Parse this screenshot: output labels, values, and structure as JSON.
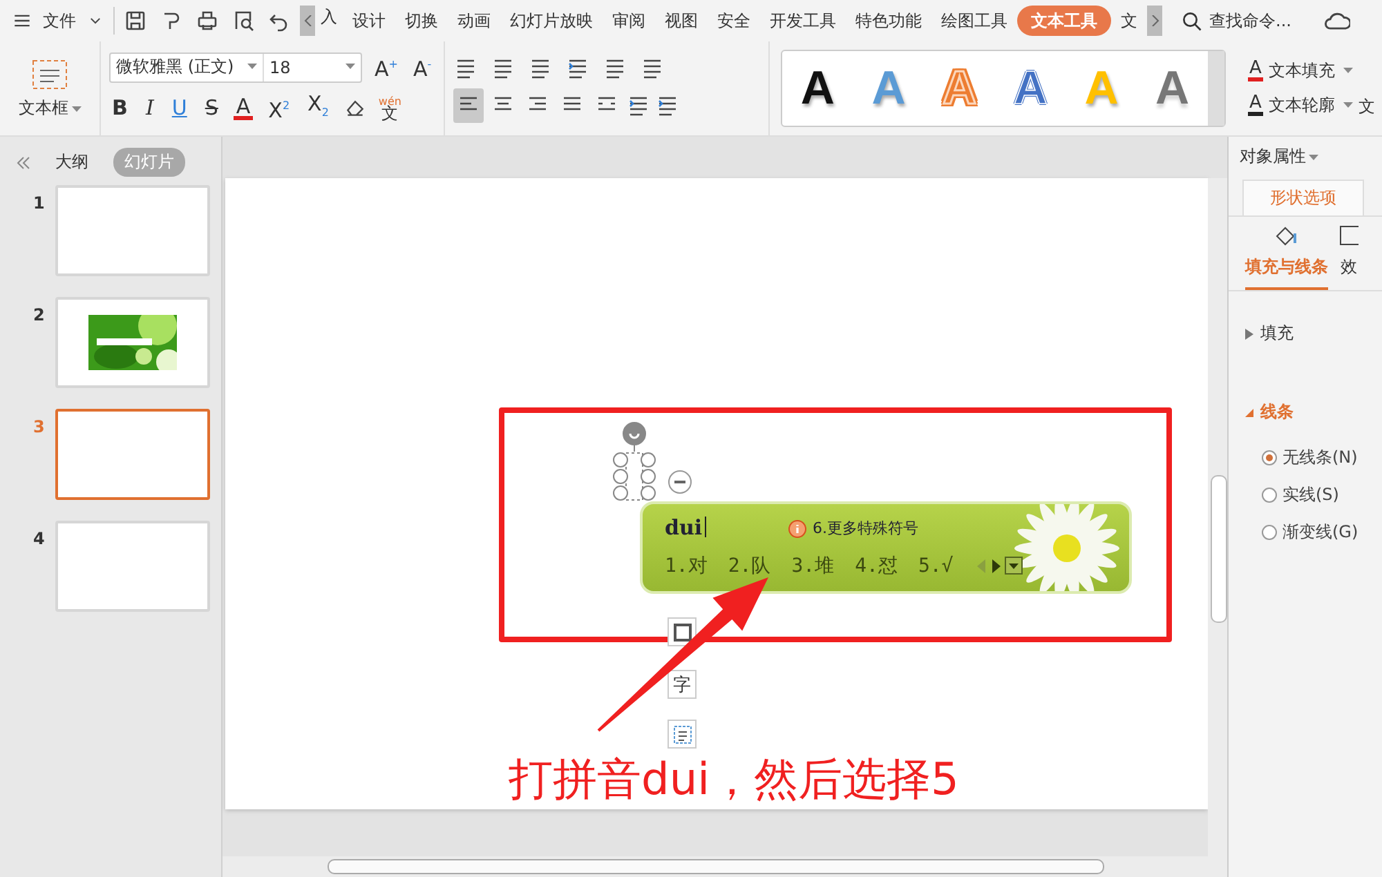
{
  "menu": {
    "file": "文件",
    "cut_tab": "入",
    "tabs": [
      {
        "label": "设计",
        "selected": false
      },
      {
        "label": "切换",
        "selected": false
      },
      {
        "label": "动画",
        "selected": false
      },
      {
        "label": "幻灯片放映",
        "selected": false
      },
      {
        "label": "审阅",
        "selected": false
      },
      {
        "label": "视图",
        "selected": false
      },
      {
        "label": "安全",
        "selected": false
      },
      {
        "label": "开发工具",
        "selected": false
      },
      {
        "label": "特色功能",
        "selected": false
      },
      {
        "label": "绘图工具",
        "selected": false
      },
      {
        "label": "文本工具",
        "selected": true
      },
      {
        "label": "文",
        "selected": false
      }
    ],
    "search": {
      "placeholder": "查找命令..."
    }
  },
  "ribbon": {
    "text_box": "文本框",
    "font_name": "微软雅黑 (正文)",
    "font_size": "18",
    "grow": "A$^{+}$",
    "shrink": "A$^{-}$",
    "format_buttons": [
      {
        "label": "B",
        "kind": "bold"
      },
      {
        "label": "I",
        "kind": "italic"
      },
      {
        "label": "U",
        "kind": "underline"
      },
      {
        "label": "S",
        "kind": "strike"
      },
      {
        "label": "A",
        "kind": "color"
      },
      {
        "label": "X$^{2}$",
        "kind": "plain"
      },
      {
        "label": "X$_{2}$",
        "kind": "plain"
      }
    ],
    "phonetic": {
      "top": "wén",
      "bottom": "文"
    },
    "alignment_buttons": [
      {
        "selected": true
      },
      {
        "selected": false
      },
      {
        "selected": false
      },
      {
        "selected": false
      },
      {
        "selected": false
      }
    ],
    "styles": [
      {
        "letter": "A",
        "color": "#111111",
        "kind": "solid"
      },
      {
        "letter": "A",
        "color": "#5b9bd5",
        "kind": "solid"
      },
      {
        "letter": "A",
        "color": "#ed7d31",
        "kind": "outline-fill"
      },
      {
        "letter": "A",
        "color": "#4472c4",
        "kind": "outline"
      },
      {
        "letter": "A",
        "color": "#ffc000",
        "kind": "solid"
      },
      {
        "letter": "A",
        "color": "#777777",
        "kind": "gradient"
      }
    ],
    "text_fill": {
      "letter": "A",
      "label": "文本填充"
    },
    "text_outline": {
      "letter": "A",
      "label": "文本轮廓"
    },
    "cut_label": "文"
  },
  "slide_panel": {
    "tabs": [
      {
        "label": "大纲",
        "selected": false
      },
      {
        "label": "幻灯片",
        "selected": true
      }
    ],
    "thumbnails": [
      {
        "number": "1",
        "selected": false,
        "kind": "blank"
      },
      {
        "number": "2",
        "selected": false,
        "kind": "picture"
      },
      {
        "number": "3",
        "selected": true,
        "kind": "blank"
      },
      {
        "number": "4",
        "selected": false,
        "kind": "blank"
      }
    ]
  },
  "slide": {
    "toolbar_glyph": "字",
    "ime": {
      "input": "dui",
      "hint": "6.更多特殊符号",
      "candidates": [
        "1.对",
        "2.队",
        "3.堆",
        "4.怼",
        "5.√"
      ]
    },
    "annotation": {
      "caption": "打拼音dui，然后选择5"
    }
  },
  "properties": {
    "title": "对象属性",
    "tab": "形状选项",
    "subtabs": [
      {
        "label": "填充与线条",
        "selected": true
      },
      {
        "label": "效",
        "selected": false
      }
    ],
    "sections": [
      {
        "label": "填充",
        "expanded": false
      },
      {
        "label": "线条",
        "expanded": true
      }
    ],
    "line_options": [
      {
        "label": "无线条(N)",
        "selected": true
      },
      {
        "label": "实线(S)",
        "selected": false
      },
      {
        "label": "渐变线(G)",
        "selected": false
      }
    ]
  }
}
